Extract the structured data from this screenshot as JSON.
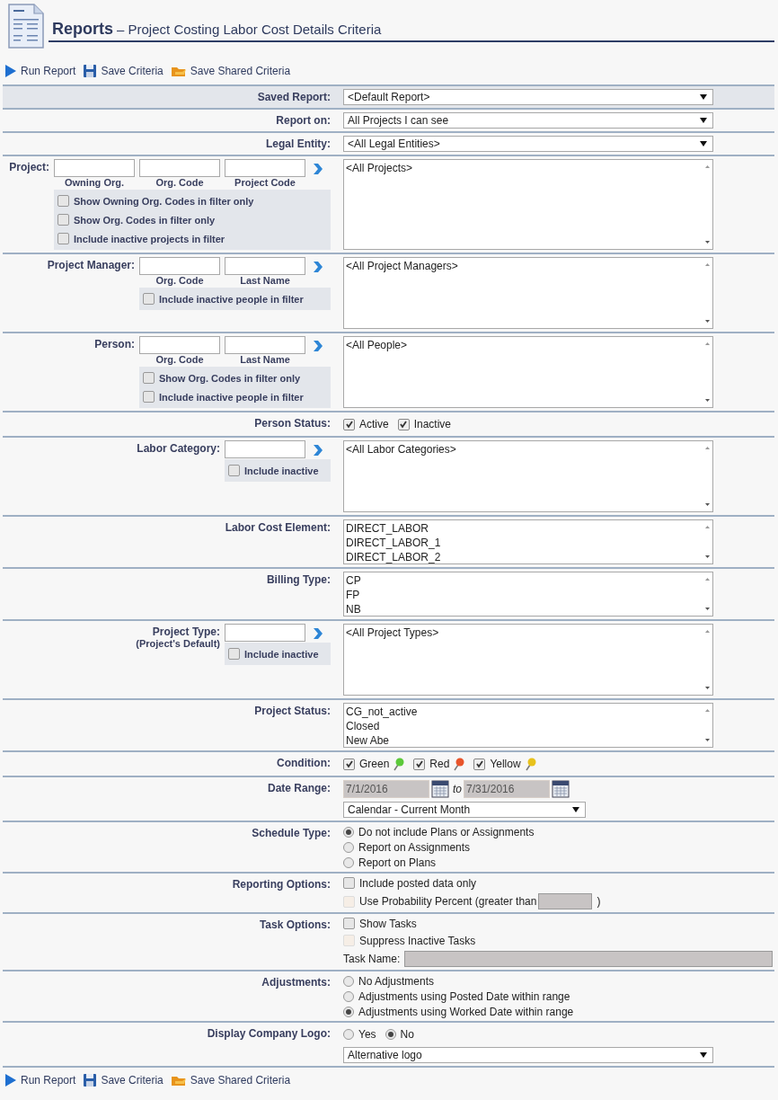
{
  "header": {
    "title": "Reports",
    "subtitle": "– Project Costing Labor Cost Details Criteria"
  },
  "toolbar": [
    {
      "kind": "run",
      "label": "Run Report"
    },
    {
      "kind": "save",
      "label": "Save Criteria"
    },
    {
      "kind": "shared",
      "label": "Save Shared Criteria"
    }
  ],
  "rows": [
    {
      "kind": "select",
      "label": "Saved Report:",
      "value": "<Default Report>",
      "shaded": true
    },
    {
      "kind": "select",
      "label": "Report on:",
      "value": "All Projects I can see",
      "shaded": false
    },
    {
      "kind": "select",
      "label": "Legal Entity:",
      "value": "<All Legal Entities>",
      "shaded": false
    },
    {
      "kind": "filter",
      "label": "Project:",
      "fields": [
        {
          "kind": "text",
          "caption": "Owning Org."
        },
        {
          "kind": "text",
          "caption": "Org. Code"
        },
        {
          "kind": "text",
          "caption": "Project Code"
        }
      ],
      "options": [
        {
          "label": "Show Owning Org. Codes in filter only",
          "checked": false
        },
        {
          "label": "Show Org. Codes in filter only",
          "checked": false
        },
        {
          "label": "Include inactive projects in filter",
          "checked": false
        }
      ],
      "items": [
        "<All Projects>"
      ]
    },
    {
      "kind": "filter",
      "label": "Project Manager:",
      "fields": [
        {
          "kind": "text",
          "caption": "Org. Code"
        },
        {
          "kind": "text",
          "caption": "Last Name"
        }
      ],
      "options": [
        {
          "label": "Include inactive people in filter",
          "checked": false
        }
      ],
      "items": [
        "<All Project Managers>"
      ]
    },
    {
      "kind": "filter",
      "label": "Person:",
      "fields": [
        {
          "kind": "text",
          "caption": "Org. Code"
        },
        {
          "kind": "text",
          "caption": "Last Name"
        }
      ],
      "options": [
        {
          "label": "Show Org. Codes in filter only",
          "checked": false
        },
        {
          "label": "Include inactive people in filter",
          "checked": false
        }
      ],
      "items": [
        "<All People>"
      ]
    },
    {
      "kind": "checks",
      "label": "Person Status:",
      "items": [
        {
          "label": "Active",
          "checked": true
        },
        {
          "label": "Inactive",
          "checked": true
        }
      ]
    },
    {
      "kind": "filter",
      "label": "Labor Category:",
      "fields": [
        {
          "kind": "text"
        }
      ],
      "options": [
        {
          "label": "Include inactive",
          "checked": false
        }
      ],
      "items": [
        "<All Labor Categories>"
      ]
    },
    {
      "kind": "list",
      "label": "Labor Cost Element:",
      "items": [
        "DIRECT_LABOR",
        "DIRECT_LABOR_1",
        "DIRECT_LABOR_2"
      ]
    },
    {
      "kind": "list",
      "label": "Billing Type:",
      "items": [
        "CP",
        "FP",
        "NB"
      ]
    },
    {
      "kind": "filter",
      "label": "Project Type:",
      "note": "(Project's Default)",
      "fields": [
        {
          "kind": "text"
        }
      ],
      "options": [
        {
          "label": "Include inactive",
          "checked": false
        }
      ],
      "items": [
        "<All Project Types>"
      ]
    },
    {
      "kind": "list",
      "label": "Project Status:",
      "items": [
        "CG_not_active",
        "Closed",
        "New Abe"
      ]
    },
    {
      "kind": "checks",
      "label": "Condition:",
      "items": [
        {
          "label": "Green",
          "checked": true,
          "color": "#5cc93a"
        },
        {
          "label": "Red",
          "checked": true,
          "color": "#e8542a"
        },
        {
          "label": "Yellow",
          "checked": true,
          "color": "#e8c21c"
        }
      ]
    },
    {
      "kind": "daterange",
      "label": "Date Range:",
      "from": "7/1/2016",
      "joiner": "to",
      "to": "7/31/2016",
      "preset": "Calendar - Current Month"
    },
    {
      "kind": "radios",
      "label": "Schedule Type:",
      "items": [
        {
          "label": "Do not include Plans or Assignments",
          "selected": true
        },
        {
          "label": "Report on Assignments",
          "selected": false
        },
        {
          "label": "Report on Plans",
          "selected": false
        }
      ]
    },
    {
      "kind": "options",
      "label": "Reporting Options:",
      "items": [
        {
          "kind": "check",
          "label": "Include posted data only",
          "checked": false,
          "disabled": false
        },
        {
          "kind": "check-field",
          "label": "Use Probability Percent (greater than",
          "suffix": ")",
          "checked": false,
          "disabled": true
        }
      ]
    },
    {
      "kind": "options",
      "label": "Task Options:",
      "items": [
        {
          "kind": "check",
          "label": "Show Tasks",
          "checked": false,
          "disabled": false
        },
        {
          "kind": "check",
          "label": "Suppress Inactive Tasks",
          "checked": false,
          "disabled": true
        },
        {
          "kind": "field",
          "label": "Task Name:"
        }
      ]
    },
    {
      "kind": "radios",
      "label": "Adjustments:",
      "items": [
        {
          "label": "No Adjustments",
          "selected": false
        },
        {
          "label": "Adjustments using Posted Date within range",
          "selected": false
        },
        {
          "label": "Adjustments using Worked Date within range",
          "selected": true
        }
      ]
    },
    {
      "kind": "logo",
      "label": "Display Company Logo:",
      "choices": [
        {
          "label": "Yes",
          "selected": false
        },
        {
          "label": "No",
          "selected": true
        }
      ],
      "value": "Alternative logo"
    }
  ],
  "bottom_toolbar": [
    {
      "kind": "run",
      "label": "Run Report"
    },
    {
      "kind": "save",
      "label": "Save Criteria"
    },
    {
      "kind": "shared",
      "label": "Save Shared Criteria"
    }
  ]
}
